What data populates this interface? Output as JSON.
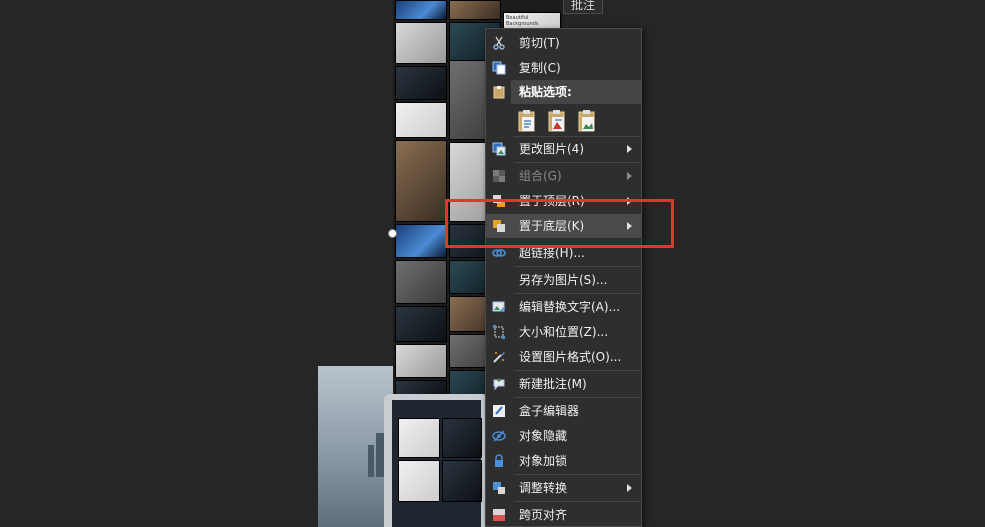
{
  "tooltip_text": "批注",
  "thumb_caption": "Beautiful Backgrounds",
  "context_menu": {
    "items": {
      "cut": "剪切(T)",
      "copy": "复制(C)",
      "paste_options": "粘贴选项:",
      "change_picture": "更改图片(4)",
      "group": "组合(G)",
      "bring_to_front": "置于顶层(R)",
      "send_to_back": "置于底层(K)",
      "hyperlink": "超链接(H)...",
      "save_as_picture": "另存为图片(S)...",
      "edit_alt_text": "编辑替换文字(A)...",
      "size_and_position": "大小和位置(Z)...",
      "format_picture": "设置图片格式(O)...",
      "new_comment": "新建批注(M)",
      "box_editor": "盒子编辑器",
      "hide_object": "对象隐藏",
      "lock_object": "对象加锁",
      "adjust_convert": "调整转换",
      "cross_page_align": "跨页对齐"
    }
  },
  "colors": {
    "menu_bg": "#2e2e2e",
    "highlight_border": "#e8322f",
    "hover_bg": "#4a4a4a"
  }
}
